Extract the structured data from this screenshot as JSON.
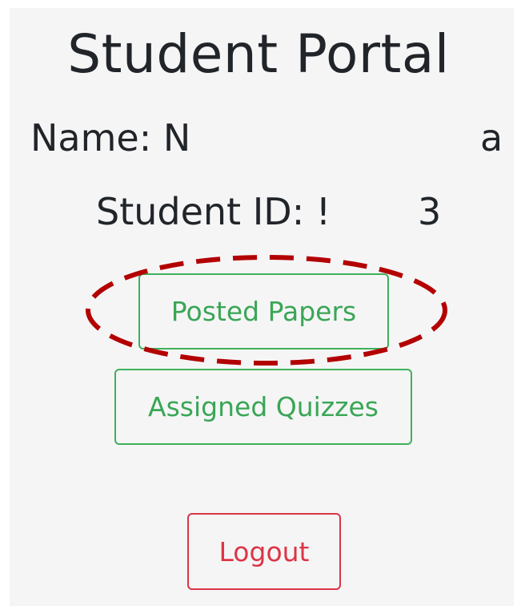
{
  "page": {
    "title": "Student Portal",
    "name_label": "Name: N",
    "name_tail": "a",
    "student_id_label": "Student ID: !",
    "student_id_tail": "3"
  },
  "actions": {
    "posted_papers_label": "Posted Papers",
    "assigned_quizzes_label": "Assigned Quizzes",
    "logout_label": "Logout"
  },
  "colors": {
    "background": "#f5f5f6",
    "success": "#3aa655",
    "danger": "#dc3545",
    "annotation": "#b30000",
    "text": "#212529"
  }
}
